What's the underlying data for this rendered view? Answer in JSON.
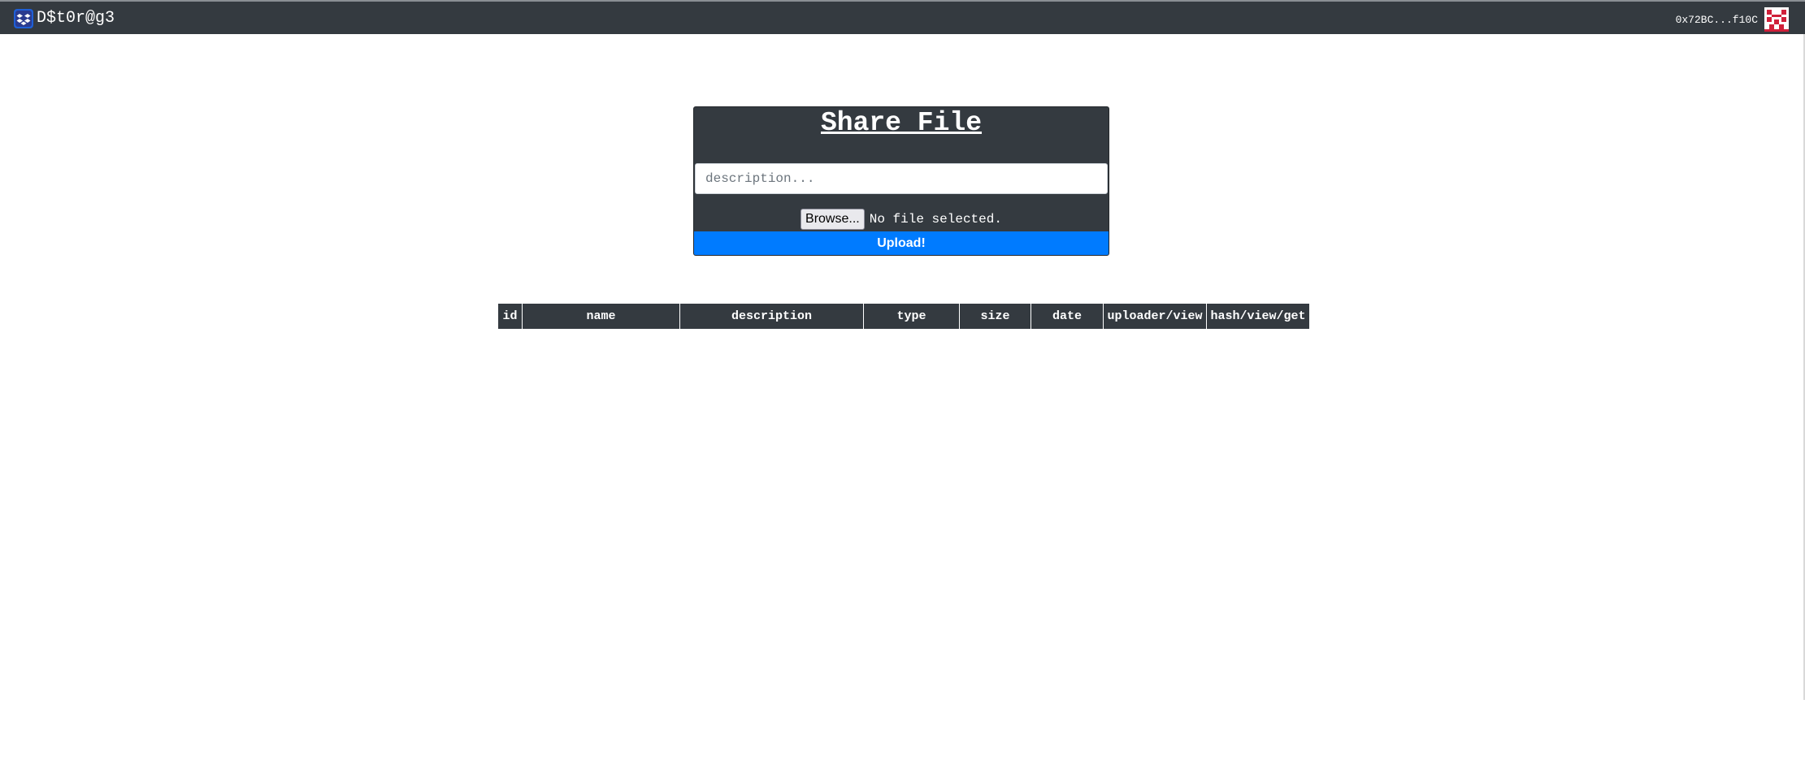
{
  "app": {
    "brand": "D$t0r@g3",
    "logo_icon": "dropbox-icon",
    "account_address": "0x72BC...f10C",
    "avatar_icon": "identicon-avatar"
  },
  "share_form": {
    "title": "Share File",
    "description_placeholder": "description...",
    "description_value": "",
    "browse_label": "Browse...",
    "file_status": "No file selected.",
    "upload_label": "Upload!"
  },
  "table": {
    "headers": [
      "id",
      "name",
      "description",
      "type",
      "size",
      "date",
      "uploader/view",
      "hash/view/get"
    ],
    "rows": []
  },
  "colors": {
    "navbar": "#343a40",
    "primary": "#007bff",
    "card": "#343a40"
  }
}
